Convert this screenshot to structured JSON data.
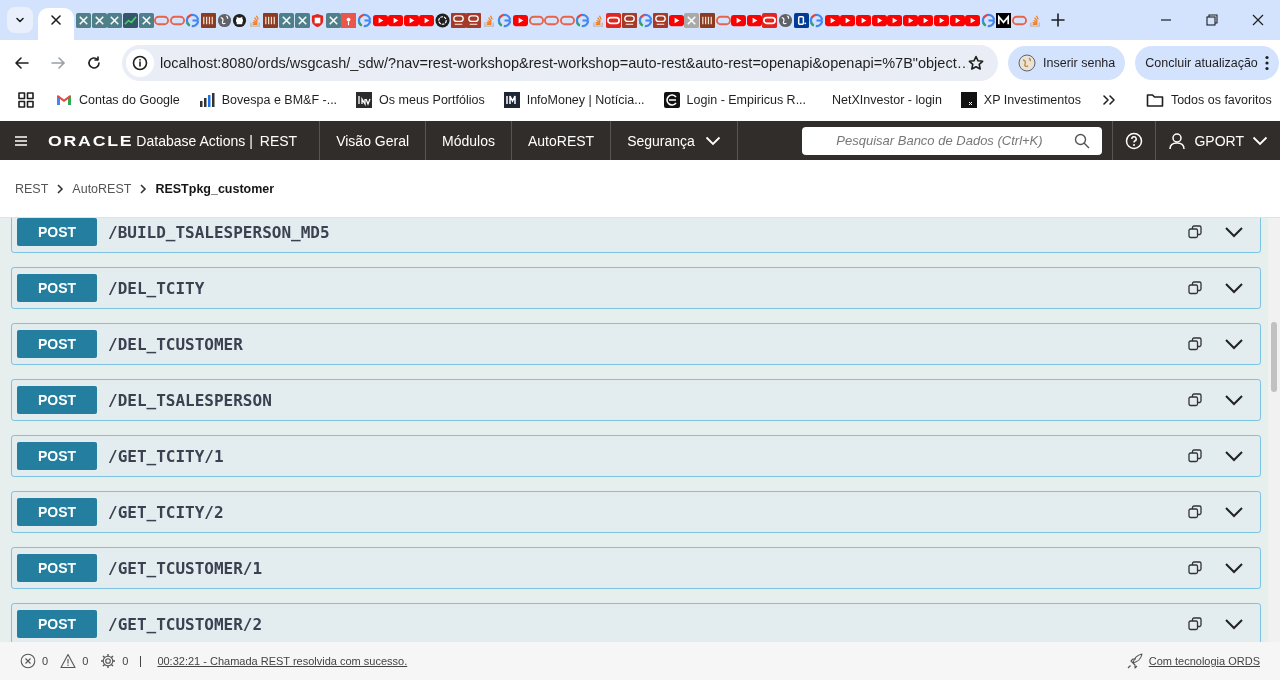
{
  "browser": {
    "tabs": [
      {
        "kind": "blank",
        "selected": true
      },
      {
        "kind": "tool",
        "selected": false
      },
      {
        "kind": "tool",
        "selected": false
      },
      {
        "kind": "tool",
        "selected": false
      },
      {
        "kind": "chart",
        "selected": false
      },
      {
        "kind": "tool",
        "selected": false
      },
      {
        "kind": "oracle",
        "selected": false
      },
      {
        "kind": "oracle",
        "selected": false
      },
      {
        "kind": "google",
        "selected": false
      },
      {
        "kind": "jeff",
        "selected": false
      },
      {
        "kind": "globe",
        "selected": false
      },
      {
        "kind": "github",
        "selected": false
      },
      {
        "kind": "stack",
        "selected": false
      },
      {
        "kind": "jeff",
        "selected": false
      },
      {
        "kind": "tool",
        "selected": false
      },
      {
        "kind": "tool",
        "selected": false
      },
      {
        "kind": "shield",
        "selected": false
      },
      {
        "kind": "tool",
        "selected": false
      },
      {
        "kind": "pin",
        "selected": false
      },
      {
        "kind": "google",
        "selected": false
      },
      {
        "kind": "youtube",
        "selected": false
      },
      {
        "kind": "youtube",
        "selected": false
      },
      {
        "kind": "youtube",
        "selected": false
      },
      {
        "kind": "youtube",
        "selected": false
      },
      {
        "kind": "openai",
        "selected": false
      },
      {
        "kind": "forum",
        "selected": false
      },
      {
        "kind": "forum",
        "selected": false
      },
      {
        "kind": "stack",
        "selected": false
      },
      {
        "kind": "google",
        "selected": false
      },
      {
        "kind": "youtube",
        "selected": false
      },
      {
        "kind": "oracle",
        "selected": false
      },
      {
        "kind": "oracle",
        "selected": false
      },
      {
        "kind": "oracle",
        "selected": false
      },
      {
        "kind": "google",
        "selected": false
      },
      {
        "kind": "stack",
        "selected": false
      },
      {
        "kind": "oracle-red",
        "selected": false
      },
      {
        "kind": "forum",
        "selected": false
      },
      {
        "kind": "google",
        "selected": false
      },
      {
        "kind": "forum",
        "selected": false
      },
      {
        "kind": "youtube",
        "selected": false
      },
      {
        "kind": "tool-grey",
        "selected": false
      },
      {
        "kind": "jeff",
        "selected": false
      },
      {
        "kind": "oracle",
        "selected": false
      },
      {
        "kind": "youtube",
        "selected": false
      },
      {
        "kind": "youtube",
        "selected": false
      },
      {
        "kind": "oracle-red",
        "selected": false
      },
      {
        "kind": "globe",
        "selected": false
      },
      {
        "kind": "booking",
        "selected": false
      },
      {
        "kind": "google",
        "selected": false
      },
      {
        "kind": "youtube",
        "selected": false
      },
      {
        "kind": "youtube",
        "selected": false
      },
      {
        "kind": "youtube",
        "selected": false
      },
      {
        "kind": "youtube",
        "selected": false
      },
      {
        "kind": "youtube",
        "selected": false
      },
      {
        "kind": "youtube",
        "selected": false
      },
      {
        "kind": "youtube",
        "selected": false
      },
      {
        "kind": "youtube",
        "selected": false
      },
      {
        "kind": "youtube",
        "selected": false
      },
      {
        "kind": "youtube",
        "selected": false
      },
      {
        "kind": "google",
        "selected": false
      },
      {
        "kind": "medium",
        "selected": false
      },
      {
        "kind": "oracle",
        "selected": false
      },
      {
        "kind": "stack",
        "selected": false
      }
    ],
    "url": "localhost:8080/ords/wsgcash/_sdw/?nav=rest-workshop&rest-workshop=auto-rest&auto-rest=openapi&openapi=%7B\"object…",
    "password_button": "Inserir senha",
    "update_button": "Concluir atualização",
    "bookmarks": [
      {
        "kind": "gmail",
        "label": "Contas do Google"
      },
      {
        "kind": "bars",
        "label": "Bovespa e BM&F -..."
      },
      {
        "kind": "inv",
        "label": "Os meus Portfólios"
      },
      {
        "kind": "im",
        "label": "InfoMoney | Notícia..."
      },
      {
        "kind": "empiricus",
        "label": "Login - Empiricus R..."
      },
      {
        "kind": "none",
        "label": "NetXInvestor - login"
      },
      {
        "kind": "xp",
        "label": "XP Investimentos"
      }
    ],
    "all_bookmarks": "Todos os favoritos"
  },
  "app_header": {
    "logo": "ORACLE",
    "product": "Database Actions |",
    "section": "REST",
    "menu": [
      "Visão Geral",
      "Módulos",
      "AutoREST",
      "Segurança"
    ],
    "search": {
      "placeholder": "Pesquisar Banco de Dados (Ctrl+K)"
    },
    "user": "GPORT"
  },
  "breadcrumb": [
    {
      "label": "REST",
      "current": false
    },
    {
      "label": "AutoREST",
      "current": false
    },
    {
      "label": "RESTpkg_customer",
      "current": true
    }
  ],
  "endpoints": [
    {
      "method": "POST",
      "path": "/BUILD_TSALESPERSON_MD5"
    },
    {
      "method": "POST",
      "path": "/DEL_TCITY"
    },
    {
      "method": "POST",
      "path": "/DEL_TCUSTOMER"
    },
    {
      "method": "POST",
      "path": "/DEL_TSALESPERSON"
    },
    {
      "method": "POST",
      "path": "/GET_TCITY/1"
    },
    {
      "method": "POST",
      "path": "/GET_TCITY/2"
    },
    {
      "method": "POST",
      "path": "/GET_TCUSTOMER/1"
    },
    {
      "method": "POST",
      "path": "/GET_TCUSTOMER/2"
    }
  ],
  "status_bar": {
    "errors": "0",
    "warnings": "0",
    "tasks": "0",
    "message": "00:32:21 - Chamada REST resolvida com sucesso.",
    "powered_by": "Com tecnologia ORDS"
  }
}
